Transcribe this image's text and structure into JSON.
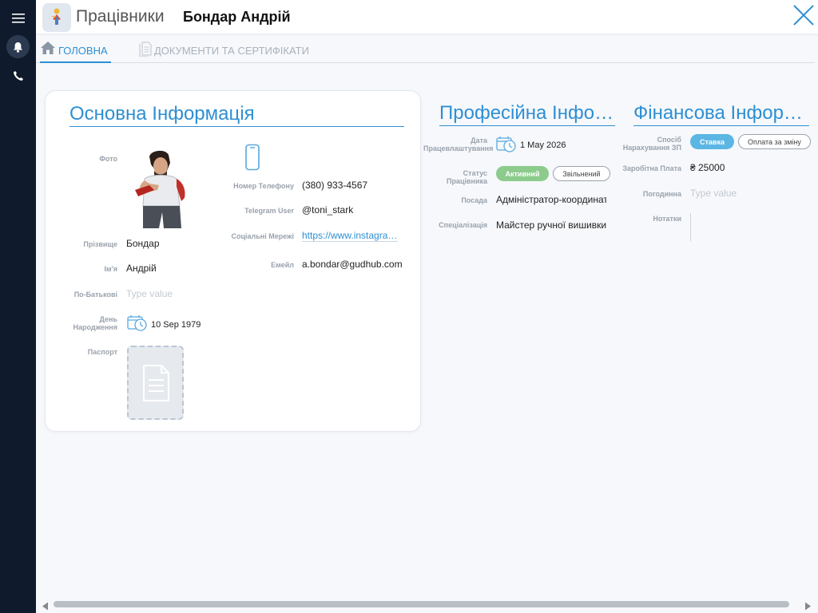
{
  "header": {
    "app_title": "Працівники",
    "person_name": "Бондар Андрій"
  },
  "tabs": [
    {
      "label": "ГОЛОВНА"
    },
    {
      "label": "ДОКУМЕНТИ ТА СЕРТИФІКАТИ"
    }
  ],
  "basic": {
    "title": "Основна Інформація",
    "photo_label": "Фото",
    "surname_label": "Прізвище",
    "surname": "Бондар",
    "name_label": "Ім'я",
    "name": "Андрій",
    "patronymic_label": "По-Батькові",
    "patronymic_placeholder": "Type value",
    "birthday_label": "День Народження",
    "birthday": "10 Sep 1979",
    "passport_label": "Паспорт",
    "phone_label": "Номер Телефону",
    "phone": "(380) 933-4567",
    "telegram_label": "Telegram User",
    "telegram": "@toni_stark",
    "social_label": "Соціальні Мережі",
    "social": "https://www.instagram.com/",
    "email_label": "Емейл",
    "email": "a.bondar@gudhub.com"
  },
  "professional": {
    "title": "Професійна Інформація",
    "hire_date_label": "Дата Працевлаштування",
    "hire_date": "1 May 2026",
    "status_label": "Статус Працівника",
    "status_active": "Активний",
    "status_fired": "Звільнений",
    "position_label": "Посада",
    "position": "Адміністратор-координатор",
    "specialization_label": "Спеціалізація",
    "specialization": "Майстер ручної вишивки"
  },
  "financial": {
    "title": "Фінансова Інформація",
    "method_label": "Спосіб Нарахування ЗП",
    "method_rate": "Ставка",
    "method_shift": "Оплата за зміну",
    "salary_label": "Заробітна Плата",
    "salary": "₴ 25000",
    "hourly_label": "Погодинна",
    "hourly_placeholder": "Type value",
    "notes_label": "Нотатки"
  },
  "colors": {
    "accent": "#2e8fd3",
    "sidebar": "#0f1b2c",
    "status_green": "#8ccb8c",
    "pill_blue": "#5bb6e4"
  },
  "icons": [
    "menu-icon",
    "bell-icon",
    "phone-icon",
    "close-icon",
    "home-icon",
    "document-icon",
    "mobile-phone-icon",
    "calendar-clock-icon",
    "arrow-left-icon",
    "arrow-right-icon"
  ]
}
